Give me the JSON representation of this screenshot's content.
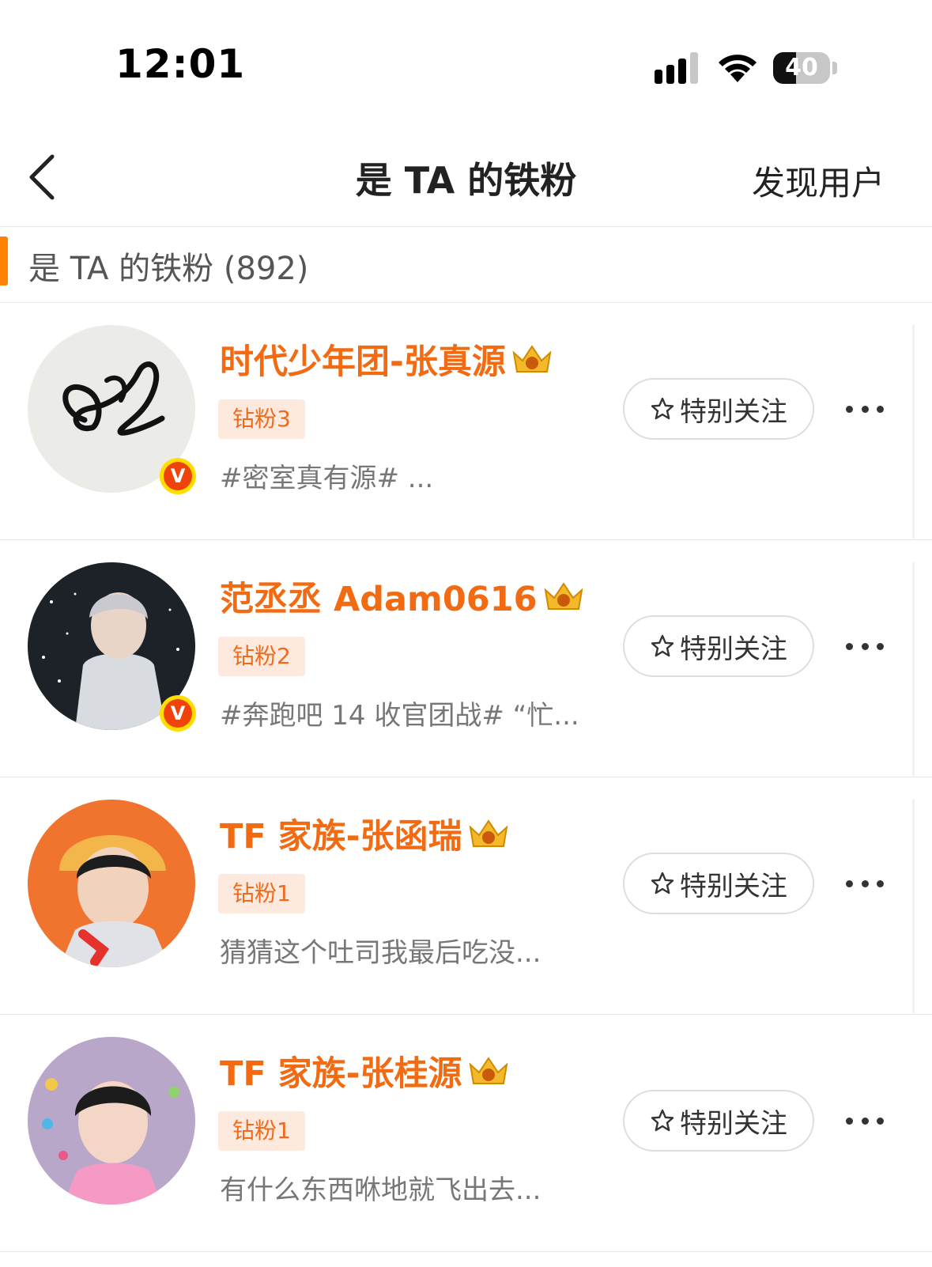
{
  "status_bar": {
    "time": "12:01",
    "battery": "40",
    "battery_level": 0.4,
    "icons": [
      "signal-icon",
      "wifi-icon",
      "battery-icon"
    ]
  },
  "nav": {
    "title": "是 TA 的铁粉",
    "discover_label": "发现用户",
    "back_icon": "chevron-left-icon"
  },
  "section": {
    "title": "是 TA 的铁粉 (892)",
    "accent": "#ff8200"
  },
  "colors": {
    "name": "#f26b12",
    "badge_bg": "#fde9dd",
    "badge_text": "#ef6b1c",
    "verified": "#f0420b"
  },
  "users": [
    {
      "name": "时代少年团-张真源",
      "badge": "钻粉3",
      "desc": "#密室真有源# ...",
      "verified": "V",
      "follow_label": "特别关注"
    },
    {
      "name": "范丞丞 Adam0616",
      "badge": "钻粉2",
      "desc": "#奔跑吧 14 收官团战# “忙...",
      "verified": "V",
      "follow_label": "特别关注"
    },
    {
      "name": "TF 家族-张函瑞",
      "badge": "钻粉1",
      "desc": "猜猜这个吐司我最后吃没...",
      "follow_label": "特别关注"
    },
    {
      "name": "TF 家族-张桂源",
      "badge": "钻粉1",
      "desc": "有什么东西咻地就飞出去...",
      "follow_label": "特别关注"
    }
  ]
}
